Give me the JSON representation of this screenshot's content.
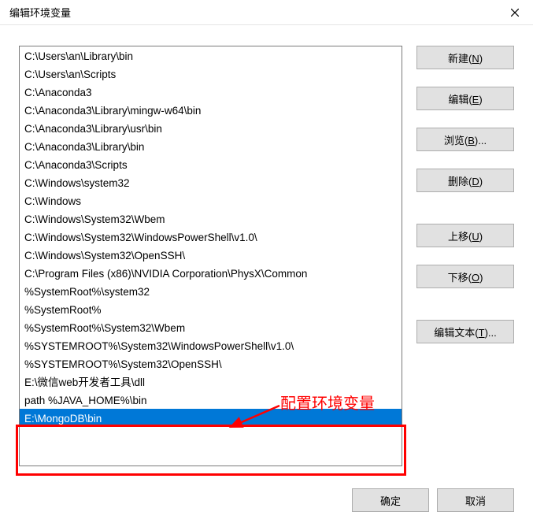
{
  "window": {
    "title": "编辑环境变量"
  },
  "list": {
    "items": [
      "C:\\Users\\an\\Library\\bin",
      "C:\\Users\\an\\Scripts",
      "C:\\Anaconda3",
      "C:\\Anaconda3\\Library\\mingw-w64\\bin",
      "C:\\Anaconda3\\Library\\usr\\bin",
      "C:\\Anaconda3\\Library\\bin",
      "C:\\Anaconda3\\Scripts",
      "C:\\Windows\\system32",
      "C:\\Windows",
      "C:\\Windows\\System32\\Wbem",
      "C:\\Windows\\System32\\WindowsPowerShell\\v1.0\\",
      "C:\\Windows\\System32\\OpenSSH\\",
      "C:\\Program Files (x86)\\NVIDIA Corporation\\PhysX\\Common",
      "%SystemRoot%\\system32",
      "%SystemRoot%",
      "%SystemRoot%\\System32\\Wbem",
      "%SYSTEMROOT%\\System32\\WindowsPowerShell\\v1.0\\",
      "%SYSTEMROOT%\\System32\\OpenSSH\\",
      "E:\\微信web开发者工具\\dll",
      "path %JAVA_HOME%\\bin",
      "E:\\MongoDB\\bin"
    ],
    "selectedIndex": 20
  },
  "buttons": {
    "new_label": "新建",
    "new_accel": "N",
    "edit_label": "编辑",
    "edit_accel": "E",
    "browse_label": "浏览",
    "browse_accel": "B",
    "delete_label": "删除",
    "delete_accel": "D",
    "moveup_label": "上移",
    "moveup_accel": "U",
    "movedown_label": "下移",
    "movedown_accel": "O",
    "edittext_label": "编辑文本",
    "edittext_accel": "T",
    "ok_label": "确定",
    "cancel_label": "取消"
  },
  "annotation": {
    "text": "配置环境变量"
  }
}
